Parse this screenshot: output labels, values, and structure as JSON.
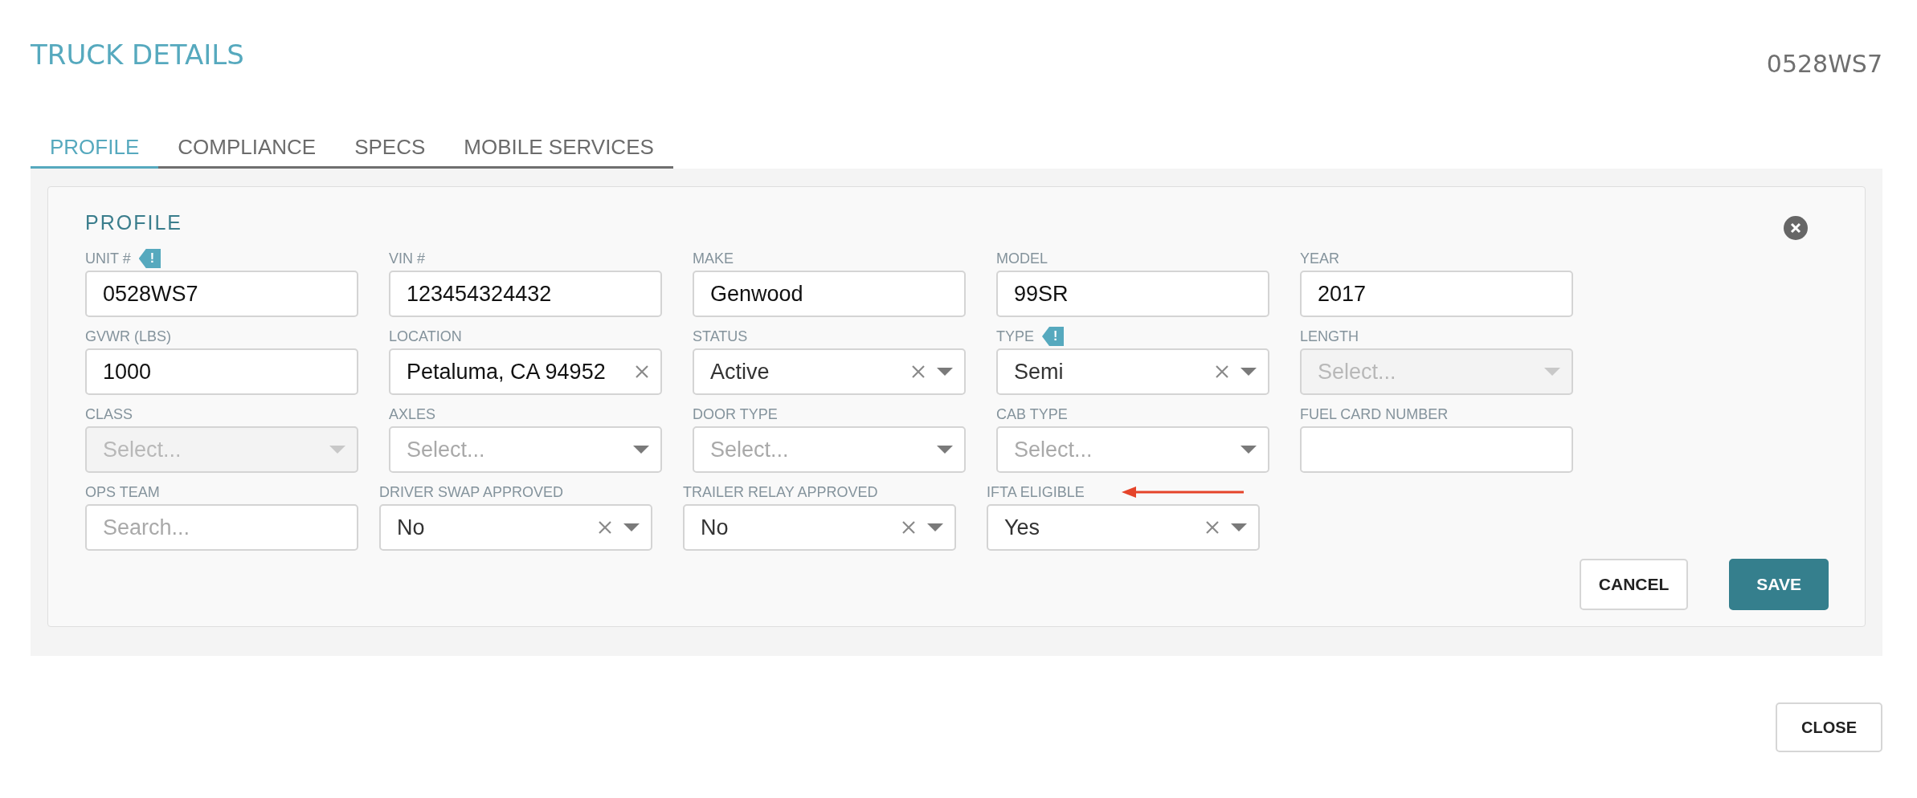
{
  "title": "TRUCK DETAILS",
  "record_id": "0528WS7",
  "tabs": [
    {
      "label": "PROFILE",
      "selected": true
    },
    {
      "label": "COMPLIANCE",
      "selected": false
    },
    {
      "label": "SPECS",
      "selected": false
    },
    {
      "label": "MOBILE SERVICES",
      "selected": false
    }
  ],
  "profile": {
    "heading": "PROFILE",
    "rows": [
      [
        {
          "label": "UNIT #",
          "badge": "!",
          "kind": "text",
          "value": "0528WS7"
        },
        {
          "label": "VIN #",
          "kind": "text",
          "value": "123454324432"
        },
        {
          "label": "MAKE",
          "kind": "text",
          "value": "Genwood"
        },
        {
          "label": "MODEL",
          "kind": "text",
          "value": "99SR"
        },
        {
          "label": "YEAR",
          "kind": "text",
          "value": "2017"
        }
      ],
      [
        {
          "label": "GVWR (LBS)",
          "kind": "text",
          "value": "1000"
        },
        {
          "label": "LOCATION",
          "kind": "text",
          "value": "Petaluma, CA 94952",
          "clearable": true
        },
        {
          "label": "STATUS",
          "kind": "select",
          "value": "Active",
          "clearable": true,
          "disabled": false
        },
        {
          "label": "TYPE",
          "badge": "!",
          "kind": "select",
          "value": "Semi",
          "clearable": true,
          "disabled": false
        },
        {
          "label": "LENGTH",
          "kind": "select",
          "placeholder": "Select...",
          "clearable": false,
          "disabled": true
        }
      ],
      [
        {
          "label": "CLASS",
          "kind": "select",
          "placeholder": "Select...",
          "clearable": false,
          "disabled": true
        },
        {
          "label": "AXLES",
          "kind": "select",
          "placeholder": "Select...",
          "clearable": false,
          "disabled": false
        },
        {
          "label": "DOOR TYPE",
          "kind": "select",
          "placeholder": "Select...",
          "clearable": false,
          "disabled": false
        },
        {
          "label": "CAB TYPE",
          "kind": "select",
          "placeholder": "Select...",
          "clearable": false,
          "disabled": false
        },
        {
          "label": "FUEL CARD NUMBER",
          "kind": "text"
        }
      ],
      [
        {
          "label": "OPS TEAM",
          "kind": "text",
          "placeholder": "Search..."
        },
        {
          "label": "DRIVER SWAP APPROVED",
          "kind": "select",
          "value": "No",
          "clearable": true,
          "disabled": false
        },
        {
          "label": "TRAILER RELAY APPROVED",
          "kind": "select",
          "value": "No",
          "clearable": true,
          "disabled": false
        },
        {
          "label": "IFTA ELIGIBLE",
          "kind": "select",
          "value": "Yes",
          "clearable": true,
          "disabled": false,
          "marked": true
        }
      ]
    ],
    "buttons": [
      {
        "label": "CANCEL",
        "kind": "secondary"
      },
      {
        "label": "SAVE",
        "kind": "primary"
      }
    ]
  },
  "close_button": "CLOSE"
}
